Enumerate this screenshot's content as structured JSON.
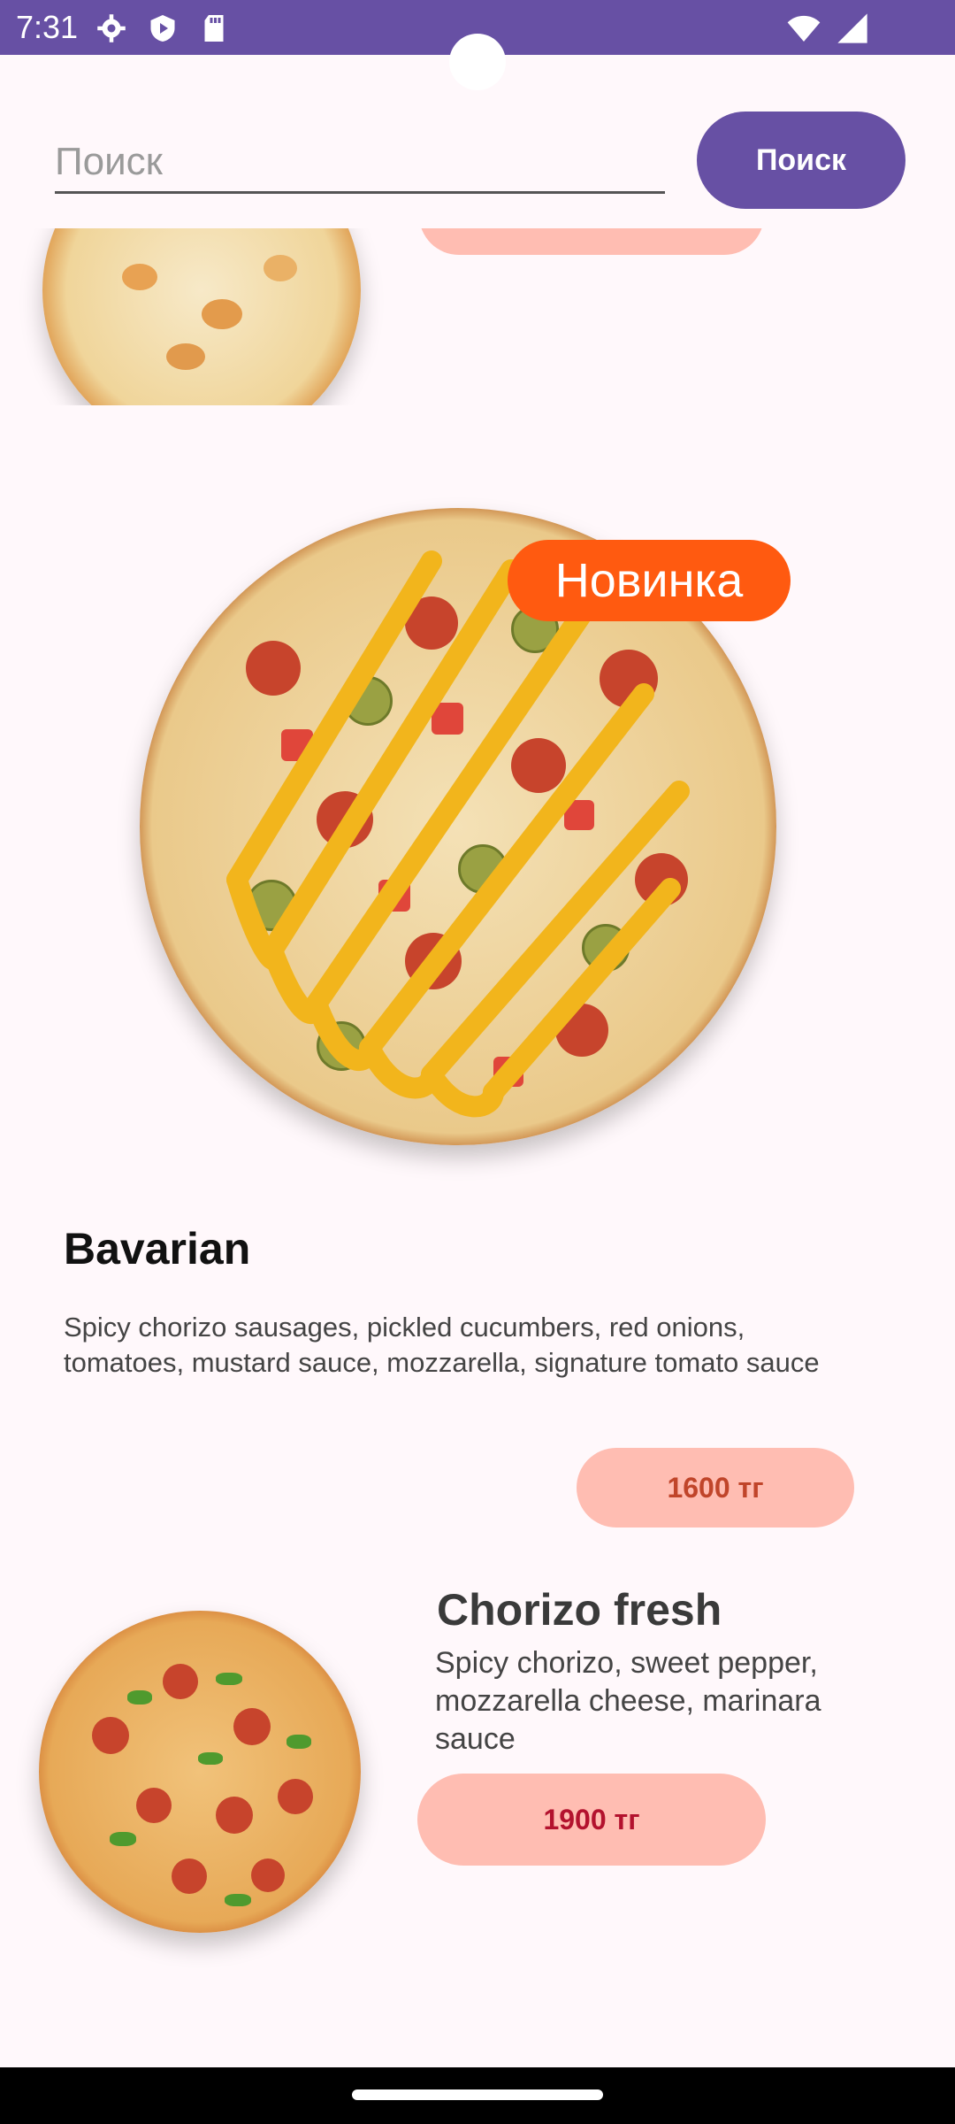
{
  "status_bar": {
    "time": "7:31",
    "icons": [
      "gear-icon",
      "shield-icon",
      "sd-card-icon",
      "wifi-icon",
      "signal-icon"
    ],
    "color": "#6750a4"
  },
  "search": {
    "placeholder": "Поиск",
    "value": "",
    "button_label": "Поиск"
  },
  "products": [
    {
      "name": "",
      "description": "",
      "price": ""
    },
    {
      "badge": "Новинка",
      "name": "Bavarian",
      "description": "Spicy chorizo sausages, pickled cucumbers, red onions, tomatoes, mustard sauce, mozzarella, signature tomato sauce",
      "price": "1600 тг"
    },
    {
      "name": "Chorizo fresh",
      "description": "Spicy chorizo, sweet pepper, mozzarella cheese, marinara sauce",
      "price": "1900 тг"
    }
  ],
  "colors": {
    "accent": "#6750a4",
    "price_pill": "#ffbdb2",
    "badge": "#ff5a10"
  }
}
